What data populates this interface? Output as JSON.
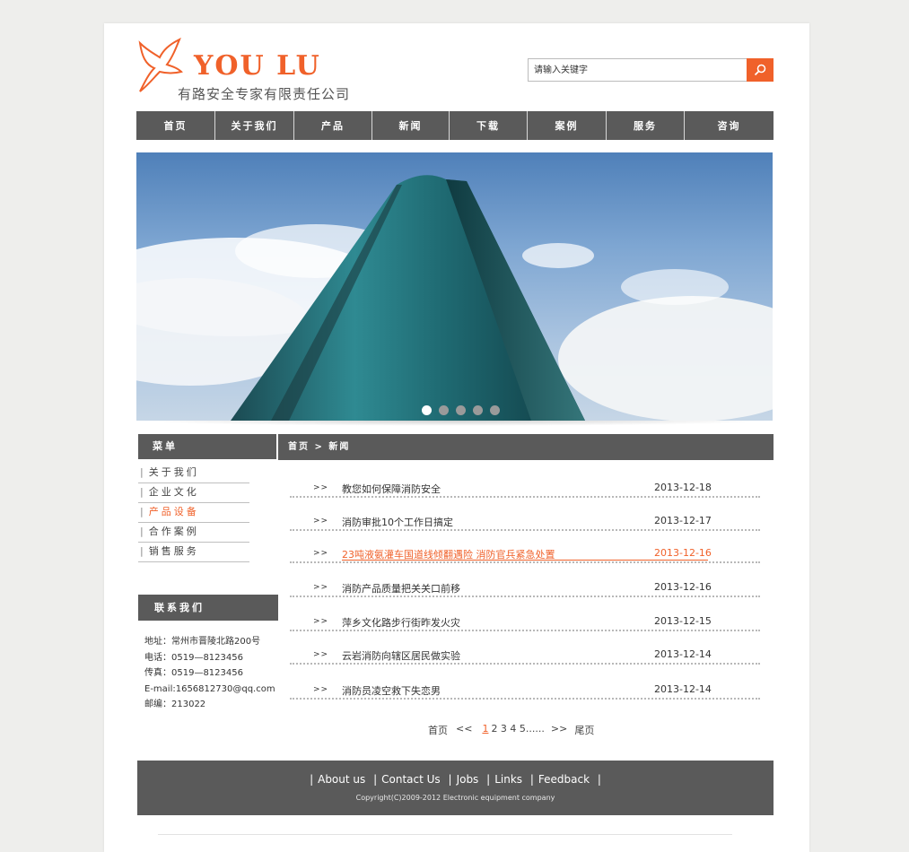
{
  "header": {
    "logo_text": "YOU LU",
    "company_name": "有路安全专家有限责任公司",
    "search_placeholder": "请输入关键字"
  },
  "nav": [
    "首页",
    "关于我们",
    "产品",
    "新闻",
    "下载",
    "案例",
    "服务",
    "咨询"
  ],
  "banner": {
    "slide_count": 5,
    "active_slide": 1
  },
  "sidebar": {
    "menu_title": "菜单",
    "items": [
      {
        "label": "关于我们",
        "active": false
      },
      {
        "label": "企业文化",
        "active": false
      },
      {
        "label": "产品设备",
        "active": true
      },
      {
        "label": "合作案例",
        "active": false
      },
      {
        "label": "销售服务",
        "active": false
      }
    ],
    "contact_title": "联系我们",
    "contact": {
      "address": "地址：常州市晋陵北路200号",
      "phone": "电话：0519—8123456",
      "fax": "传真：0519—8123456",
      "email": "E-mail:1656812730@qq.com",
      "zip": "邮编：213022"
    }
  },
  "breadcrumb": "首页 > 新闻",
  "news": [
    {
      "arrow": ">>",
      "title": "教您如何保障消防安全",
      "date": "2013-12-18"
    },
    {
      "arrow": ">>",
      "title": "消防审批10个工作日搞定",
      "date": "2013-12-17"
    },
    {
      "arrow": ">>",
      "title": "23吨液氨灌车国道线倾翻遇险  消防官兵紧急处置",
      "date": "2013-12-16"
    },
    {
      "arrow": ">>",
      "title": "消防产品质量把关关口前移",
      "date": "2013-12-16"
    },
    {
      "arrow": ">>",
      "title": "萍乡文化路步行街昨发火灾",
      "date": "2013-12-15"
    },
    {
      "arrow": ">>",
      "title": "云岩消防向辖区居民做实验",
      "date": "2013-12-14"
    },
    {
      "arrow": ">>",
      "title": "消防员凌空救下失恋男",
      "date": "2013-12-14"
    }
  ],
  "pager": {
    "first": "首页",
    "prev": "<<",
    "current": "1",
    "pages": "2 3 4 5......",
    "next": ">>",
    "last": "尾页"
  },
  "footer": {
    "links": [
      "About us",
      "Contact Us",
      "Jobs",
      "Links",
      "Feedback"
    ],
    "copyright": "Copyright(C)2009-2012 Electronic equipment company"
  },
  "colors": {
    "accent": "#f0612a",
    "bar": "#5a5a5a"
  }
}
